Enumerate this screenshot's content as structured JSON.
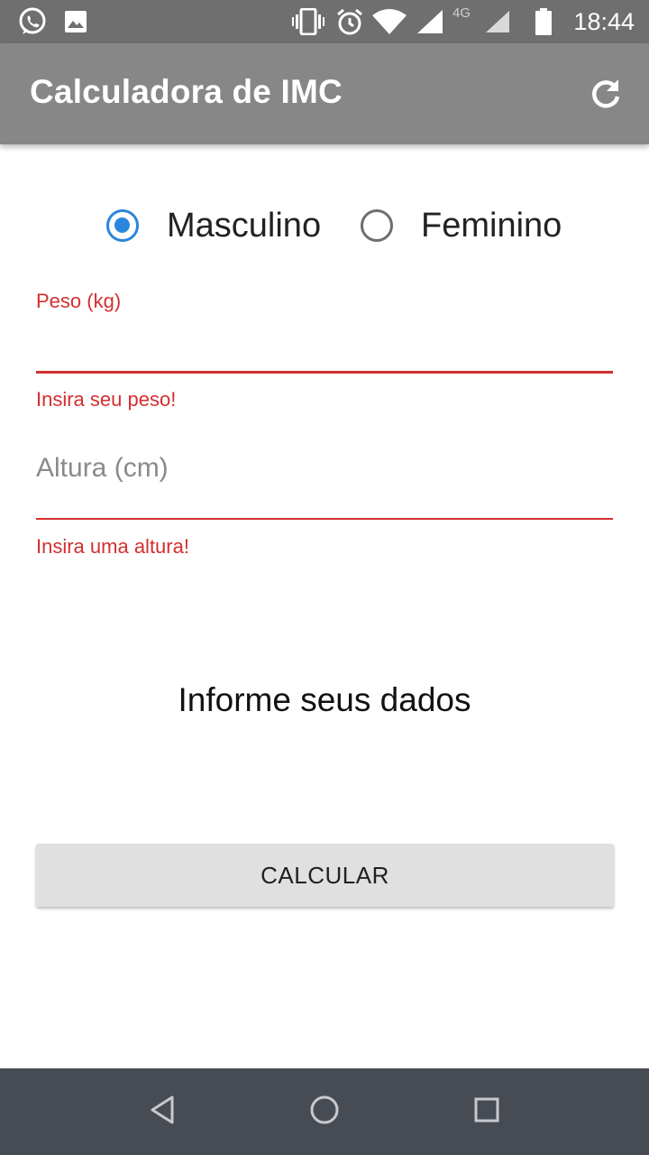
{
  "status_bar": {
    "time": "18:44",
    "network_type": "4G",
    "icons": [
      "whatsapp-icon",
      "image-icon",
      "vibrate-icon",
      "alarm-icon",
      "wifi-icon",
      "signal-icon",
      "signal-secondary-icon",
      "battery-icon"
    ]
  },
  "app_bar": {
    "title": "Calculadora de IMC",
    "action_icon": "refresh-icon"
  },
  "gender": {
    "options": [
      {
        "label": "Masculino",
        "checked": true
      },
      {
        "label": "Feminino",
        "checked": false
      }
    ]
  },
  "weight": {
    "label": "Peso (kg)",
    "value": "",
    "error": "Insira seu peso!"
  },
  "height": {
    "placeholder": "Altura (cm)",
    "value": "",
    "error": "Insira uma altura!"
  },
  "info": {
    "text": "Informe seus dados"
  },
  "calculate": {
    "label": "CALCULAR"
  },
  "navigation": {
    "icons": [
      "back-icon",
      "home-icon",
      "recents-icon"
    ]
  },
  "colors": {
    "status_bar": "#6f6f6f",
    "app_bar": "#878787",
    "radio_accent": "#2a86dc",
    "error": "#d32f2f",
    "button": "#e0e0e0",
    "nav_bar": "#474c54"
  }
}
